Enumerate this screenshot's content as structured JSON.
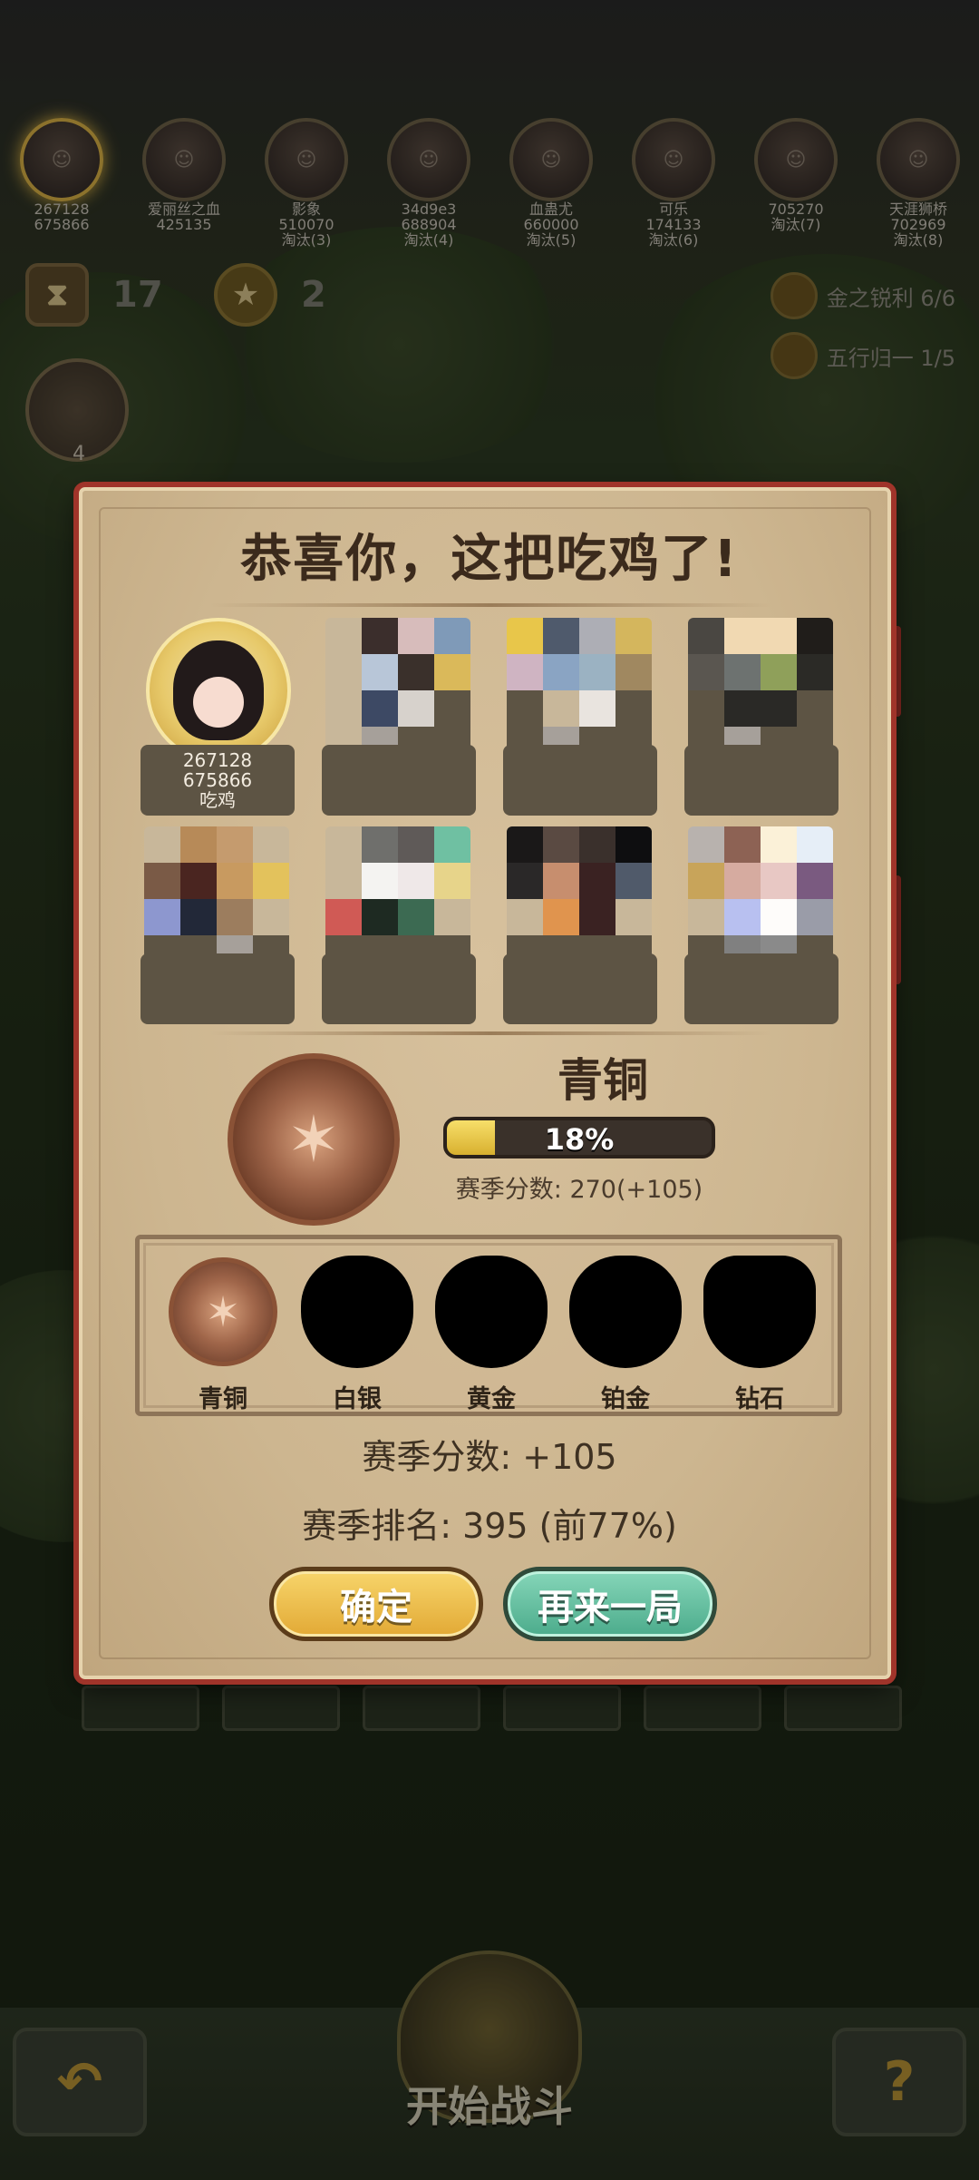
{
  "players": [
    {
      "name": "267128",
      "score": "675866",
      "status": ""
    },
    {
      "name": "爱丽丝之血",
      "score": "425135",
      "status": ""
    },
    {
      "name": "影象",
      "score": "510070",
      "status": "淘汰(3)"
    },
    {
      "name": "34d9e3",
      "score": "688904",
      "status": "淘汰(4)"
    },
    {
      "name": "血蛊尤",
      "score": "660000",
      "status": "淘汰(5)"
    },
    {
      "name": "可乐",
      "score": "174133",
      "status": "淘汰(6)"
    },
    {
      "name": "",
      "score": "705270",
      "status": "淘汰(7)"
    },
    {
      "name": "天涯狮桥",
      "score": "702969",
      "status": "淘汰(8)"
    }
  ],
  "hud": {
    "turns": "17",
    "coins": "2",
    "side_count": "4",
    "buffs": [
      {
        "label": "金之锐利 6/6",
        "icon": "gold-sword-icon"
      },
      {
        "label": "五行归一 1/5",
        "icon": "five-elements-icon"
      }
    ]
  },
  "dialog": {
    "title": "恭喜你，这把吃鸡了!",
    "winner": {
      "line1": "267128",
      "line2": "675866",
      "line3": "吃鸡"
    },
    "rank_name": "青铜",
    "progress_percent": 18,
    "progress_label": "18%",
    "season_score_line": "赛季分数: 270(+105)",
    "tiers": [
      {
        "label": "青铜",
        "icon": "bronze-medal-icon",
        "unlocked": true
      },
      {
        "label": "白银",
        "icon": "silver-medal-icon",
        "unlocked": false
      },
      {
        "label": "黄金",
        "icon": "gold-medal-icon",
        "unlocked": false
      },
      {
        "label": "铂金",
        "icon": "platinum-medal-icon",
        "unlocked": false
      },
      {
        "label": "钻石",
        "icon": "diamond-medal-icon",
        "unlocked": false
      }
    ],
    "season_score_delta": "赛季分数: +105",
    "season_rank": "赛季排名: 395 (前77%)",
    "confirm_label": "确定",
    "again_label": "再来一局"
  },
  "bottom": {
    "start_label": "开始战斗",
    "back_icon": "back-arrow-icon",
    "help_icon": "help-icon"
  }
}
